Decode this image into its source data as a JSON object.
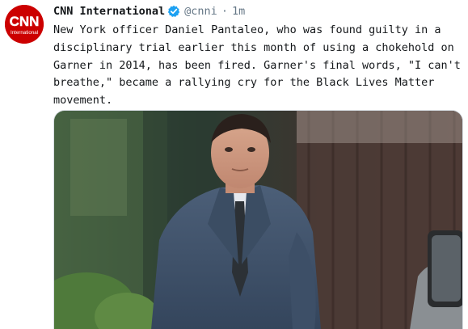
{
  "tweet": {
    "author_name": "CNN International",
    "handle": "@cnni",
    "separator": "·",
    "time": "1m",
    "text": "New York officer Daniel Pantaleo, who was found guilty in a disciplinary trial earlier this month of using a chokehold on Garner in 2014, has been fired. Garner's final words, \"I can't breathe,\" became a rallying cry for the Black Lives Matter movement."
  },
  "avatar": {
    "logo_text": "CNN",
    "logo_subtext": "International",
    "brand_color": "#cc0000"
  },
  "icons": {
    "verified": "verified-badge-icon"
  },
  "colors": {
    "text": "#14171a",
    "secondary": "#657786",
    "verified": "#1da1f2"
  }
}
